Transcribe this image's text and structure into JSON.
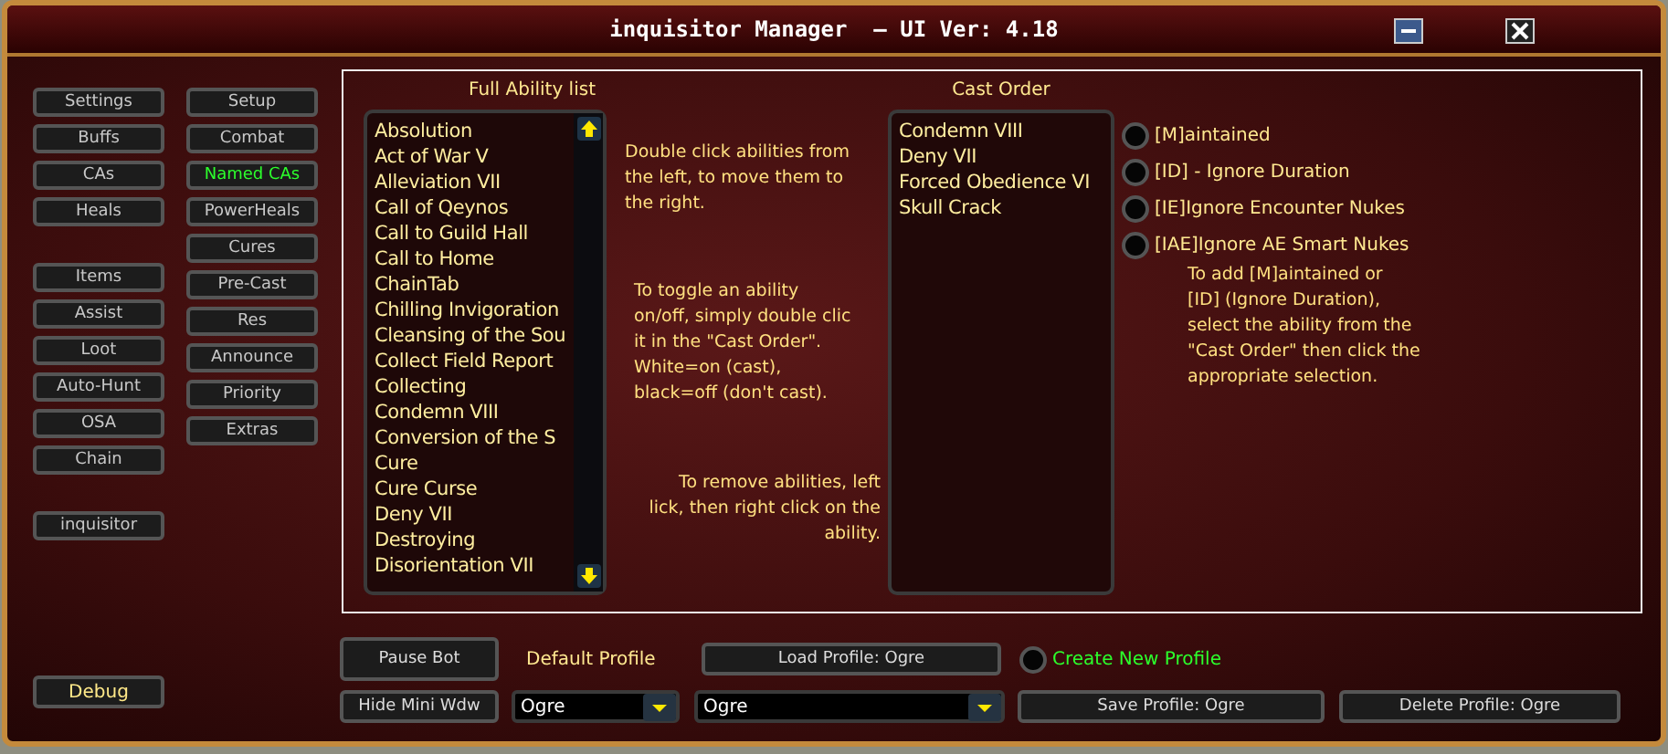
{
  "window": {
    "title": "inquisitor Manager  — UI Ver: 4.18"
  },
  "nav": {
    "left_groups": [
      [
        {
          "label": "Settings",
          "selected": false
        },
        {
          "label": "Buffs",
          "selected": false
        },
        {
          "label": "CAs",
          "selected": false
        },
        {
          "label": "Heals",
          "selected": false
        }
      ],
      [
        {
          "label": "Items",
          "selected": false
        },
        {
          "label": "Assist",
          "selected": false
        },
        {
          "label": "Loot",
          "selected": false
        },
        {
          "label": "Auto-Hunt",
          "selected": false
        },
        {
          "label": "OSA",
          "selected": false
        },
        {
          "label": "Chain",
          "selected": false
        }
      ],
      [
        {
          "label": "inquisitor",
          "selected": false
        }
      ]
    ],
    "right": [
      {
        "label": "Setup",
        "selected": false
      },
      {
        "label": "Combat",
        "selected": false
      },
      {
        "label": "Named CAs",
        "selected": true
      },
      {
        "label": "PowerHeals",
        "selected": false
      },
      {
        "label": "Cures",
        "selected": false
      },
      {
        "label": "Pre-Cast",
        "selected": false
      },
      {
        "label": "Res",
        "selected": false
      },
      {
        "label": "Announce",
        "selected": false
      },
      {
        "label": "Priority",
        "selected": false
      },
      {
        "label": "Extras",
        "selected": false
      }
    ],
    "debug": "Debug"
  },
  "ability_list": {
    "title": "Full Ability list",
    "items": [
      "Absolution",
      "Act of War V",
      "Alleviation VII",
      "Call of Qeynos",
      "Call to Guild Hall",
      "Call to Home",
      "ChainTab",
      "Chilling Invigoration",
      "Cleansing of the Sou",
      "Collect Field Report",
      "Collecting",
      "Condemn VIII",
      "Conversion of the S",
      "Cure",
      "Cure Curse",
      "Deny VII",
      "Destroying",
      "Disorientation VII"
    ]
  },
  "help": [
    "Double click abilities from\nthe left, to move them to\nthe right.",
    "To toggle an ability\non/off, simply double clic\nit in the \"Cast Order\".\nWhite=on (cast),\nblack=off (don't cast).",
    "To remove abilities, left\nlick, then right click on the\nability."
  ],
  "cast_order": {
    "title": "Cast Order",
    "items": [
      "Condemn VIII",
      "Deny VII",
      "Forced Obedience VI",
      "Skull Crack"
    ]
  },
  "options": [
    {
      "label": "[M]aintained",
      "checked": false
    },
    {
      "label": "[ID] - Ignore Duration",
      "checked": false
    },
    {
      "label": "[IE]Ignore Encounter Nukes",
      "checked": false
    },
    {
      "label": "[IAE]Ignore AE Smart Nukes",
      "checked": false
    }
  ],
  "options_help": "To add [M]aintained or\n[ID] (Ignore Duration),\nselect the ability from the\n\"Cast Order\" then click the\nappropriate selection.",
  "bottom": {
    "pause": "Pause Bot",
    "hide": "Hide Mini Wdw",
    "default_profile_label": "Default Profile",
    "default_profile": "Ogre",
    "profile": "Ogre",
    "load": "Load Profile: Ogre",
    "create": {
      "label": "Create New Profile",
      "checked": false
    },
    "save": "Save Profile: Ogre",
    "delete": "Delete Profile: Ogre"
  }
}
